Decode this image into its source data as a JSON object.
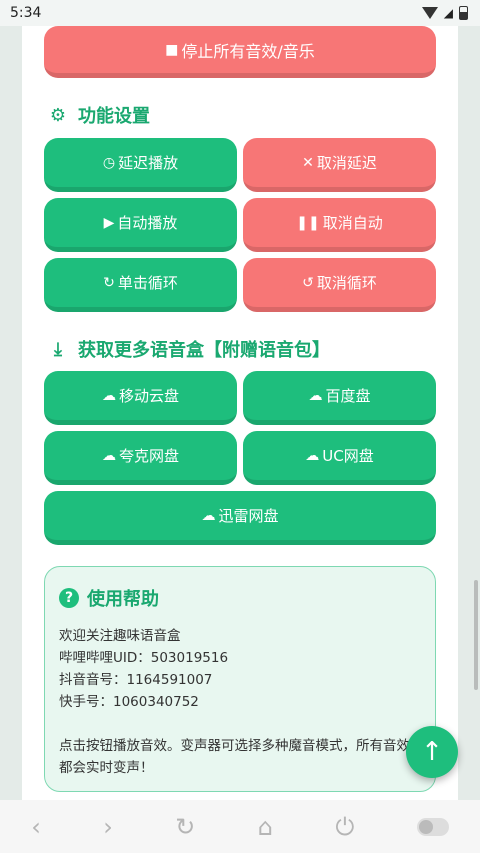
{
  "status_bar": {
    "time": "5:34",
    "icons": [
      "wifi-icon",
      "signal-icon",
      "battery-icon"
    ]
  },
  "colors": {
    "green": "#1ebe7d",
    "red": "#f77676",
    "title_green": "#1aa870"
  },
  "stop_button": {
    "icon": "stop-square-icon",
    "label": "停止所有音效/音乐"
  },
  "function_settings": {
    "icon": "gear-icon",
    "title": "功能设置",
    "buttons": [
      {
        "icon": "clock-icon",
        "label": "延迟播放"
      },
      {
        "icon": "x-icon",
        "label": "取消延迟"
      },
      {
        "icon": "play-icon",
        "label": "自动播放"
      },
      {
        "icon": "pause-icon",
        "label": "取消自动"
      },
      {
        "icon": "refresh-icon",
        "label": "单击循环"
      },
      {
        "icon": "undo-icon",
        "label": "取消循环"
      }
    ]
  },
  "download_section": {
    "icon": "download-icon",
    "title": "获取更多语音盒【附赠语音包】",
    "buttons": [
      {
        "icon": "cloud-icon",
        "label": "移动云盘"
      },
      {
        "icon": "cloud-icon",
        "label": "百度盘"
      },
      {
        "icon": "cloud-icon",
        "label": "夸克网盘"
      },
      {
        "icon": "cloud-icon",
        "label": "UC网盘"
      },
      {
        "icon": "cloud-icon",
        "label": "迅雷网盘"
      }
    ]
  },
  "help": {
    "icon": "question-icon",
    "title": "使用帮助",
    "lines": [
      "欢迎关注趣味语音盒",
      "哔哩哔哩UID：503019516",
      "抖音音号：1164591007",
      "快手号：1060340752"
    ],
    "paragraph": "点击按钮播放音效。变声器可选择多种魔音模式，所有音效都会实时变声！"
  },
  "fab": {
    "icon": "arrow-up-icon"
  },
  "nav_bar": {
    "items": [
      "back-icon",
      "forward-icon",
      "refresh-icon",
      "home-icon",
      "power-icon",
      "toggle-icon"
    ]
  }
}
